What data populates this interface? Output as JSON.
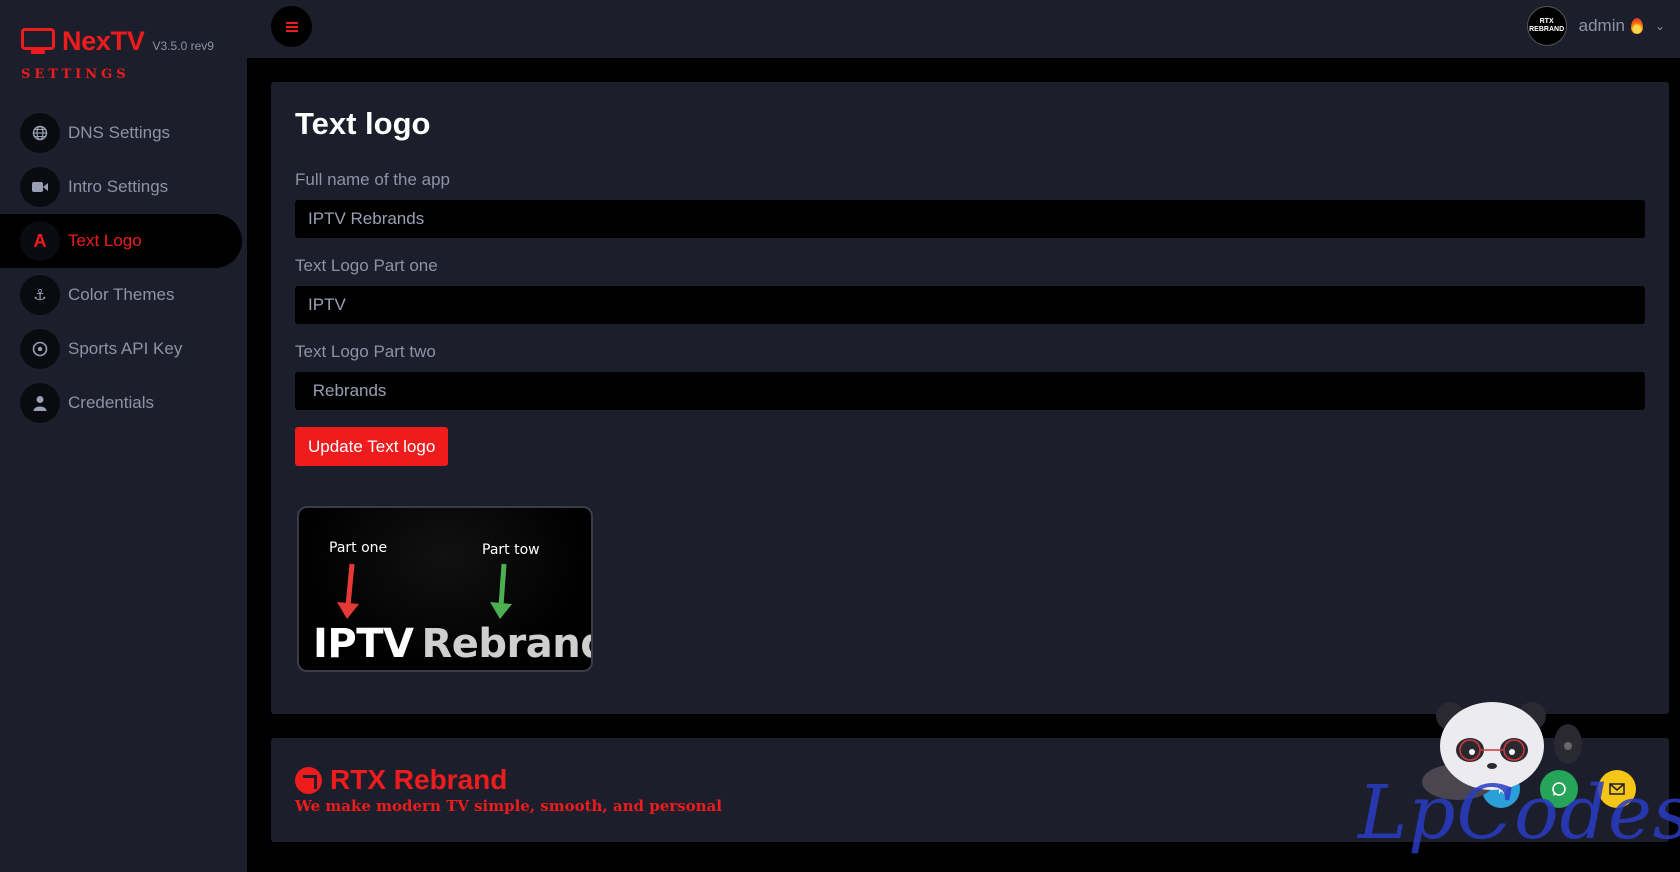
{
  "brand": {
    "name": "NexTV",
    "version": "V3.5.0 rev9",
    "subtitle": "SETTINGS"
  },
  "sidebar": {
    "items": [
      {
        "label": "DNS Settings",
        "icon": "globe-icon",
        "active": false
      },
      {
        "label": "Intro Settings",
        "icon": "video-camera-icon",
        "active": false
      },
      {
        "label": "Text Logo",
        "icon": "letter-a-icon",
        "active": true
      },
      {
        "label": "Color Themes",
        "icon": "anchor-icon",
        "active": false
      },
      {
        "label": "Sports API Key",
        "icon": "soccer-ball-icon",
        "active": false
      },
      {
        "label": "Credentials",
        "icon": "user-icon",
        "active": false
      }
    ]
  },
  "topbar": {
    "avatar_text": "RTX REBRAND",
    "user_name": "admin"
  },
  "form": {
    "title": "Text logo",
    "full_name_label": "Full name of the app",
    "full_name_value": "IPTV Rebrands",
    "part_one_label": "Text Logo Part one",
    "part_one_value": "IPTV",
    "part_two_label": "Text Logo Part two",
    "part_two_value": " Rebrands",
    "submit_label": "Update Text logo"
  },
  "preview": {
    "part_one_caption": "Part one",
    "part_two_caption": "Part tow",
    "text_one": "IPTV",
    "text_two": "Rebrands"
  },
  "footer": {
    "title": "RTX Rebrand",
    "tagline": "We make modern TV simple, smooth, and personal"
  },
  "watermark": "LpCodes",
  "colors": {
    "accent": "#ee1c1c",
    "panel": "#1c1f2b",
    "background": "#000000",
    "muted_text": "#8c93a8"
  }
}
